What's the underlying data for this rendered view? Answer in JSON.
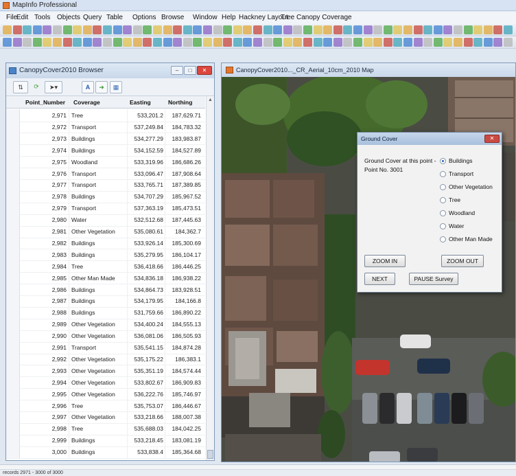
{
  "app": {
    "title": "MapInfo Professional"
  },
  "menu": [
    "File",
    "Edit",
    "Tools",
    "Objects",
    "Query",
    "Table",
    "Options",
    "Browse",
    "Window",
    "Help",
    "Hackney Layout",
    "Tree Canopy Coverage"
  ],
  "browser": {
    "title": "CanopyCover2010 Browser",
    "columns": [
      "Point_Number",
      "Coverage",
      "Easting",
      "Northing"
    ],
    "rows": [
      [
        "2,971",
        "Tree",
        "533,201.2",
        "187,629.71"
      ],
      [
        "2,972",
        "Transport",
        "537,249.84",
        "184,783.32"
      ],
      [
        "2,973",
        "Buildings",
        "534,277.29",
        "183,983.87"
      ],
      [
        "2,974",
        "Buildings",
        "534,152.59",
        "184,527.89"
      ],
      [
        "2,975",
        "Woodland",
        "533,319.96",
        "186,686.26"
      ],
      [
        "2,976",
        "Transport",
        "533,096.47",
        "187,908.64"
      ],
      [
        "2,977",
        "Transport",
        "533,765.71",
        "187,389.85"
      ],
      [
        "2,978",
        "Buildings",
        "534,707.29",
        "185,967.52"
      ],
      [
        "2,979",
        "Transport",
        "537,363.19",
        "185,473.51"
      ],
      [
        "2,980",
        "Water",
        "532,512.68",
        "187,445.63"
      ],
      [
        "2,981",
        "Other Vegetation",
        "535,080.61",
        "184,362.7"
      ],
      [
        "2,982",
        "Buildings",
        "533,926.14",
        "185,300.69"
      ],
      [
        "2,983",
        "Buildings",
        "535,279.95",
        "186,104.17"
      ],
      [
        "2,984",
        "Tree",
        "536,418.66",
        "186,446.25"
      ],
      [
        "2,985",
        "Other Man Made",
        "534,836.18",
        "186,938.22"
      ],
      [
        "2,986",
        "Buildings",
        "534,864.73",
        "183,928.51"
      ],
      [
        "2,987",
        "Buildings",
        "534,179.95",
        "184,166.8"
      ],
      [
        "2,988",
        "Buildings",
        "531,759.66",
        "186,890.22"
      ],
      [
        "2,989",
        "Other Vegetation",
        "534,400.24",
        "184,555.13"
      ],
      [
        "2,990",
        "Other Vegetation",
        "536,081.06",
        "186,505.93"
      ],
      [
        "2,991",
        "Transport",
        "535,541.15",
        "184,874.28"
      ],
      [
        "2,992",
        "Other Vegetation",
        "535,175.22",
        "186,383.1"
      ],
      [
        "2,993",
        "Other Vegetation",
        "535,351.19",
        "184,574.44"
      ],
      [
        "2,994",
        "Other Vegetation",
        "533,802.67",
        "186,909.83"
      ],
      [
        "2,995",
        "Other Vegetation",
        "536,222.76",
        "185,746.97"
      ],
      [
        "2,996",
        "Tree",
        "535,753.07",
        "186,446.67"
      ],
      [
        "2,997",
        "Other Vegetation",
        "533,218.66",
        "188,007.38"
      ],
      [
        "2,998",
        "Tree",
        "535,688.03",
        "184,042.25"
      ],
      [
        "2,999",
        "Buildings",
        "533,218.45",
        "183,081.19"
      ],
      [
        "3,000",
        "Buildings",
        "533,838.4",
        "185,364.68"
      ]
    ]
  },
  "map": {
    "title": "CanopyCover2010..._CR_Aerial_10cm_2010 Map"
  },
  "dialog": {
    "title": "Ground Cover",
    "prompt": "Ground Cover at this point -",
    "point": "Point No. 3001",
    "options": [
      "Buildings",
      "Transport",
      "Other Vegetation",
      "Tree",
      "Woodland",
      "Water",
      "Other Man Made"
    ],
    "selected": "Buildings",
    "zoom_in": "ZOOM IN",
    "zoom_out": "ZOOM OUT",
    "next": "NEXT",
    "pause": "PAUSE Survey"
  },
  "status": "records 2971 - 3000 of 3000"
}
